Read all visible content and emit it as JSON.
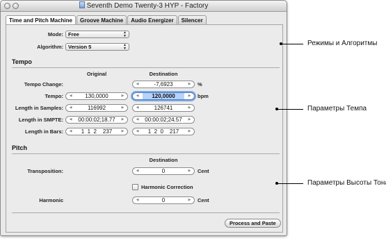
{
  "window": {
    "title": "Seventh Demo Twenty-3 HYP - Factory"
  },
  "tabs": [
    {
      "label": "Time and Pitch Machine",
      "active": true
    },
    {
      "label": "Groove Machine",
      "active": false
    },
    {
      "label": "Audio Energizer",
      "active": false
    },
    {
      "label": "Silencer",
      "active": false
    }
  ],
  "modes": {
    "mode_label": "Mode:",
    "mode_value": "Free",
    "algorithm_label": "Algorithm:",
    "algorithm_value": "Version 5"
  },
  "tempo": {
    "section_title": "Tempo",
    "col_original": "Original",
    "col_destination": "Destination",
    "rows": [
      {
        "label": "Tempo Change:",
        "original": null,
        "destination": "-7,6923",
        "unit": "%"
      },
      {
        "label": "Tempo:",
        "original": "130,0000",
        "destination": "120,0000",
        "unit": "bpm"
      },
      {
        "label": "Length in Samples:",
        "original": "116992",
        "destination": "126741",
        "unit": ""
      },
      {
        "label": "Length in SMPTE:",
        "original": "00:00:02;18.77",
        "destination": "00:00:02;24.57",
        "unit": ""
      },
      {
        "label": "Length in Bars:",
        "original": "1  1  2    237",
        "destination": "1  2  0    217",
        "unit": ""
      }
    ]
  },
  "pitch": {
    "section_title": "Pitch",
    "col_destination": "Destination",
    "transposition_label": "Transposition:",
    "transposition_value": "0",
    "transposition_unit": "Cent",
    "harmonic_correction_label": "Harmonic Correction",
    "harmonic_correction_checked": false,
    "harmonic_label": "Harmonic",
    "harmonic_value": "0",
    "harmonic_unit": "Cent"
  },
  "actions": {
    "process_label": "Process and Paste"
  },
  "callouts": [
    {
      "text": "Режимы и Алгоритмы"
    },
    {
      "text": "Параметры Темпа"
    },
    {
      "text": "Параметры Высоты Тона"
    }
  ]
}
